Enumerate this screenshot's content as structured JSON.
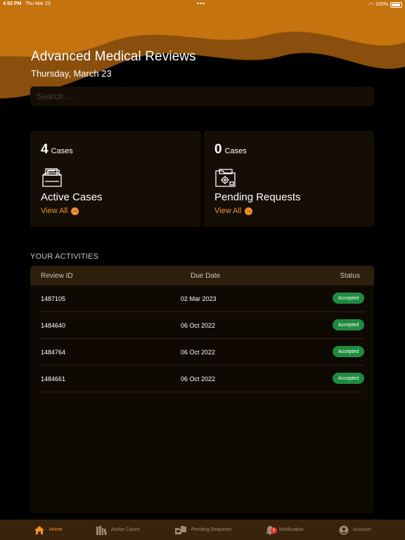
{
  "status_bar": {
    "time": "4:52 PM",
    "date": "Thu Mar 23",
    "battery": "100%"
  },
  "header": {
    "title": "Advanced Medical Reviews",
    "date": "Thursday, March 23"
  },
  "search": {
    "placeholder": "Search ...."
  },
  "cards": [
    {
      "count": "4",
      "unit": "Cases",
      "label": "Active Cases",
      "link": "View All",
      "icon": "folder-documents-icon"
    },
    {
      "count": "0",
      "unit": "Cases",
      "label": "Pending Requests",
      "link": "View All",
      "icon": "folder-gear-icon"
    }
  ],
  "activities": {
    "section_title": "YOUR ACTIVITIES",
    "columns": [
      "Review ID",
      "Due Date",
      "Status"
    ],
    "rows": [
      {
        "id": "1487105",
        "due": "02 Mar 2023",
        "status": "Accepted"
      },
      {
        "id": "1484640",
        "due": "06 Oct 2022",
        "status": "Accepted"
      },
      {
        "id": "1484764",
        "due": "06 Oct 2022",
        "status": "Accepted"
      },
      {
        "id": "1484661",
        "due": "06 Oct 2022",
        "status": "Accepted"
      }
    ]
  },
  "tabbar": {
    "items": [
      {
        "label": "Home",
        "icon": "home-icon",
        "active": true
      },
      {
        "label": "Active Cases",
        "icon": "books-icon",
        "active": false
      },
      {
        "label": "Pending Requests",
        "icon": "folders-icon",
        "active": false
      },
      {
        "label": "Notification",
        "icon": "bell-icon",
        "active": false,
        "badge": "1"
      },
      {
        "label": "Account",
        "icon": "user-icon",
        "active": false
      }
    ]
  },
  "colors": {
    "accent": "#f0902a",
    "wave_top": "#c4730f",
    "wave_dark": "#8a4f0c",
    "card_bg": "#150e07",
    "status_green": "#1f8b3f",
    "tabbar_bg": "#3a230c"
  }
}
